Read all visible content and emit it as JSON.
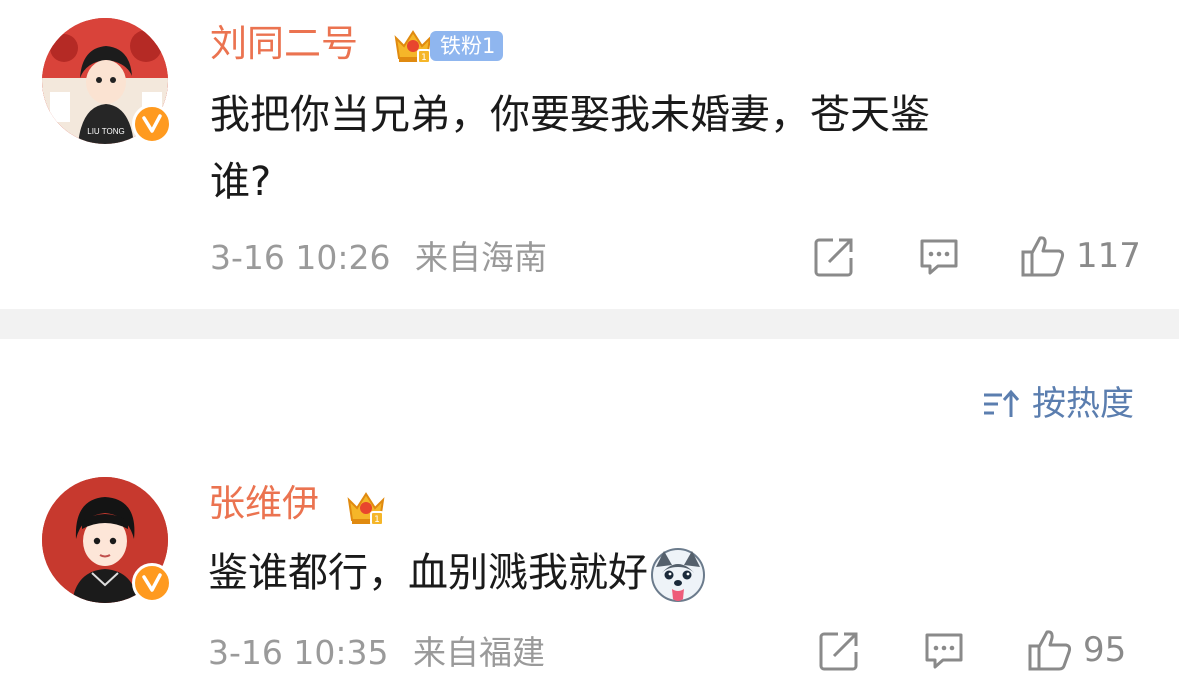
{
  "comments": [
    {
      "username": "刘同二号",
      "fan_badge": "铁粉1",
      "text_line1": "我把你当兄弟，你要娶我未婚妻，苍天鉴",
      "text_line2": "谁?",
      "timestamp": "3-16 10:26",
      "location": "来自海南",
      "likes": "117",
      "avatar_caption": "LIU TONG"
    },
    {
      "username": "张维伊",
      "text_line1": "鉴谁都行，血别溅我就好",
      "emoji": "husky-tongue-emoji",
      "timestamp": "3-16 10:35",
      "location": "来自福建",
      "likes": "95"
    }
  ],
  "sort": {
    "label": "按热度",
    "icon": "sort-icon"
  },
  "icons": {
    "share": "share-icon",
    "comment": "comment-icon",
    "like": "thumbs-up-icon",
    "verified": "verified-badge-icon",
    "crown": "crown-badge-icon"
  },
  "colors": {
    "username": "#eb7350",
    "text": "#1a1a1a",
    "meta": "#9a9a9a",
    "link": "#5b7eaf",
    "fan_badge": "#8fb6ef",
    "verified": "#ff9a1f",
    "separator": "#f2f2f2"
  }
}
